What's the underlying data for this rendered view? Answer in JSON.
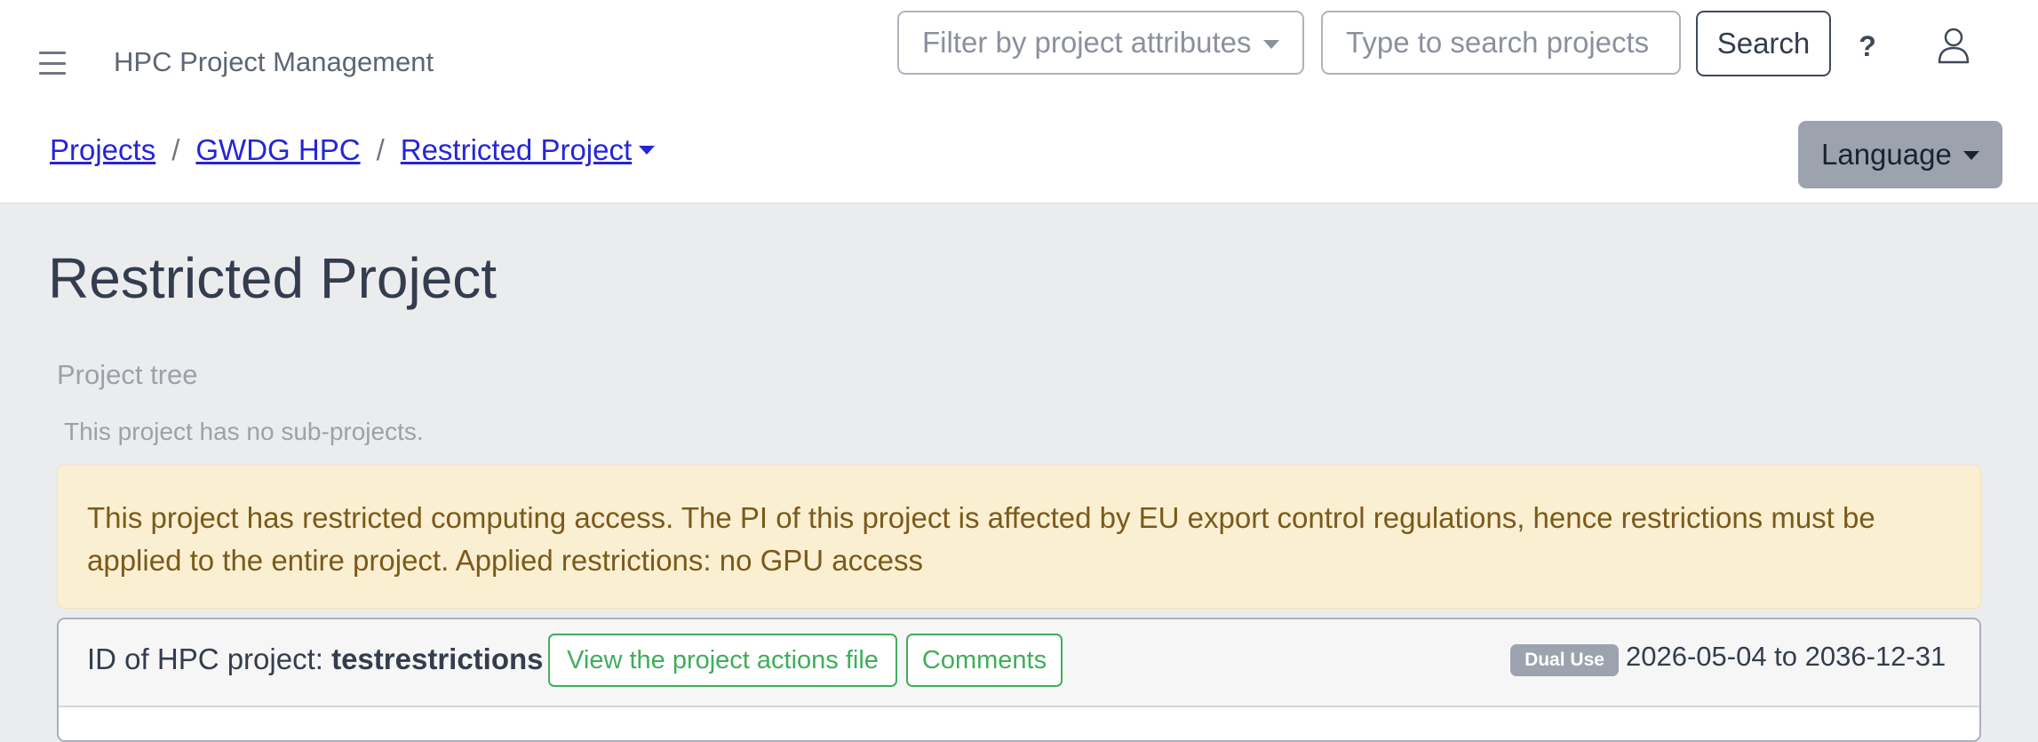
{
  "header": {
    "app_title": "HPC Project Management",
    "filter_placeholder": "Filter by project attributes",
    "search_placeholder": "Type to search projects",
    "search_button": "Search",
    "help_label": "?",
    "menu_icon": "hamburger-menu-icon",
    "user_icon": "user-icon"
  },
  "breadcrumb": {
    "items": [
      "Projects",
      "GWDG HPC",
      "Restricted Project"
    ],
    "separator": "/"
  },
  "language": {
    "label": "Language"
  },
  "page": {
    "title": "Restricted Project",
    "project_tree_heading": "Project tree",
    "no_subprojects": "This project has no sub-projects."
  },
  "alert": {
    "text": "This project has restricted computing access. The PI of this project is affected by EU export control regulations, hence restrictions must be applied to the entire project. Applied restrictions: no GPU access"
  },
  "project_card": {
    "id_label": "ID of HPC project: ",
    "id_value": "testrestrictions",
    "actions_button": "View the project actions file",
    "comments_button": "Comments",
    "badge": "Dual Use",
    "date_range": "2026-05-04 to 2036-12-31"
  },
  "colors": {
    "link": "#2525d6",
    "alert_bg": "#fbefd2",
    "success": "#3fae5a",
    "badge_bg": "#9ca3af"
  }
}
